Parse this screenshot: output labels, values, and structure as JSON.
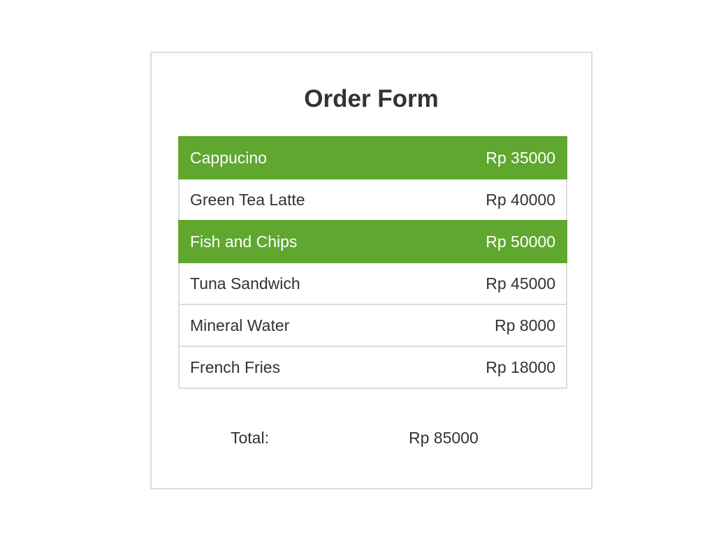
{
  "title": "Order Form",
  "colors": {
    "selected": "#5fa72f",
    "border": "#dddddd",
    "text": "#333333"
  },
  "items": [
    {
      "name": "Cappucino",
      "price": "Rp 35000",
      "selected": true
    },
    {
      "name": "Green Tea Latte",
      "price": "Rp 40000",
      "selected": false
    },
    {
      "name": "Fish and Chips",
      "price": "Rp 50000",
      "selected": true
    },
    {
      "name": "Tuna Sandwich",
      "price": "Rp 45000",
      "selected": false
    },
    {
      "name": "Mineral Water",
      "price": "Rp 8000",
      "selected": false
    },
    {
      "name": "French Fries",
      "price": "Rp 18000",
      "selected": false
    }
  ],
  "total": {
    "label": "Total:",
    "value": "Rp 85000"
  }
}
